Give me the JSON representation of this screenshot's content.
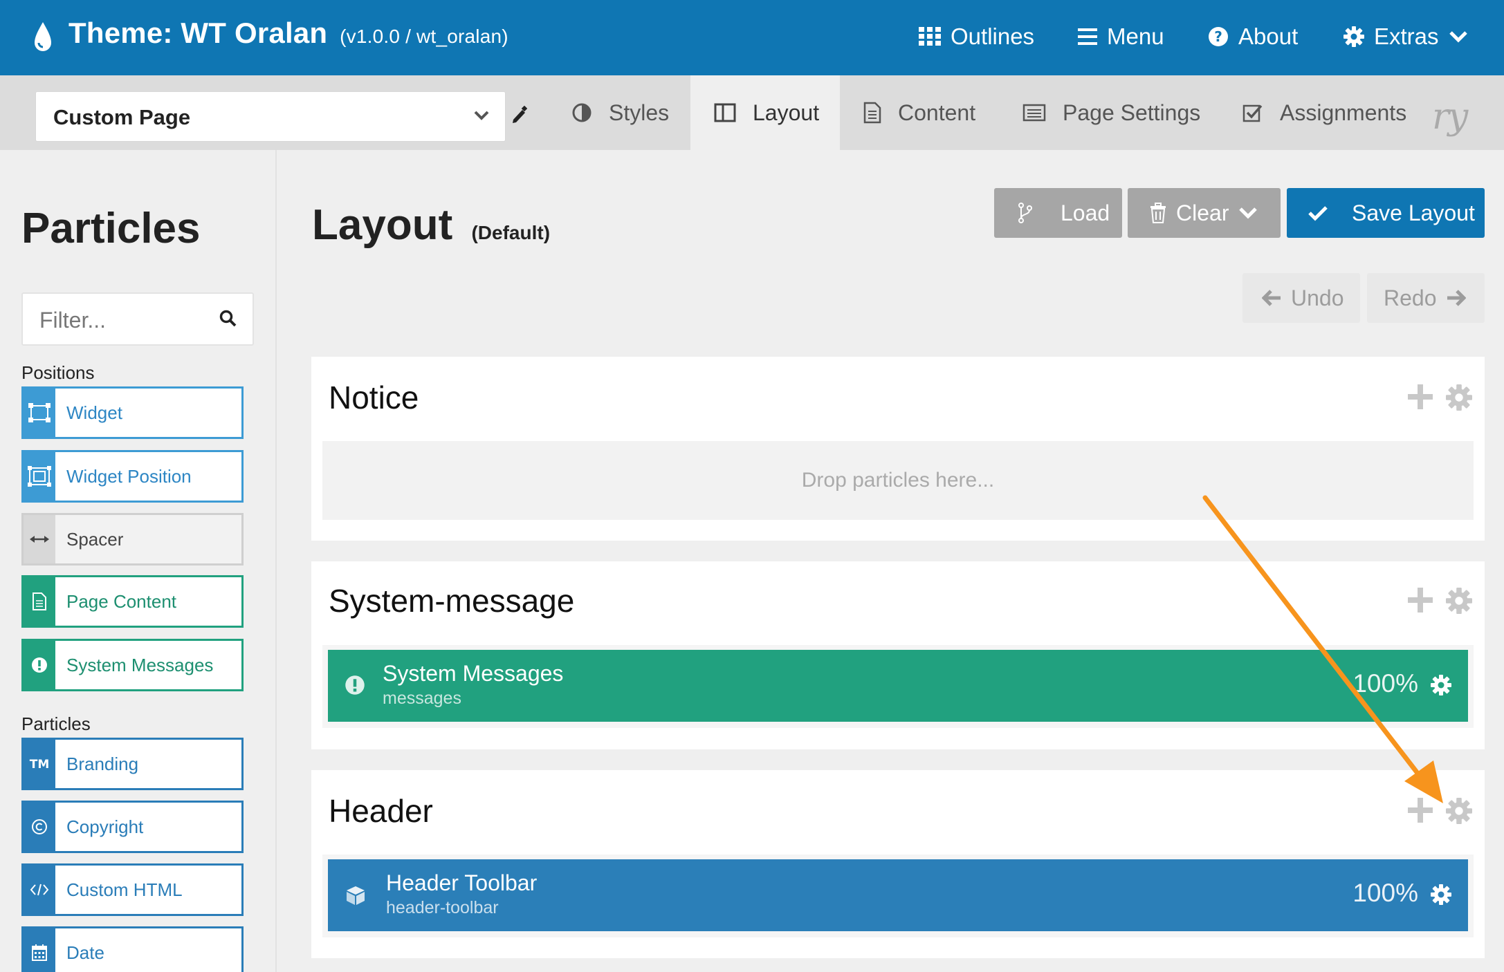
{
  "header": {
    "title": "Theme: WT Oralan",
    "version": "(v1.0.0 / wt_oralan)",
    "nav": {
      "outlines": "Outlines",
      "menu": "Menu",
      "about": "About",
      "extras": "Extras"
    }
  },
  "subbar": {
    "outline_value": "Custom Page",
    "tabs": {
      "styles": "Styles",
      "layout": "Layout",
      "content": "Content",
      "page_settings": "Page Settings",
      "assignments": "Assignments"
    },
    "brand_fragment": "ry"
  },
  "sidebar": {
    "title": "Particles",
    "filter_placeholder": "Filter...",
    "positions_label": "Positions",
    "positions": [
      "Widget",
      "Widget Position",
      "Spacer",
      "Page Content",
      "System Messages"
    ],
    "particles_label": "Particles",
    "particles": [
      "Branding",
      "Copyright",
      "Custom HTML",
      "Date"
    ]
  },
  "main": {
    "title": "Layout",
    "subtitle": "(Default)",
    "buttons": {
      "load": "Load",
      "clear": "Clear",
      "save": "Save Layout",
      "undo": "Undo",
      "redo": "Redo"
    },
    "sections": {
      "notice": {
        "name": "Notice",
        "drop_text": "Drop particles here..."
      },
      "system_message": {
        "name": "System-message",
        "particle_title": "System Messages",
        "particle_sub": "messages",
        "particle_width": "100%"
      },
      "header": {
        "name": "Header",
        "particle_title": "Header Toolbar",
        "particle_sub": "header-toolbar",
        "particle_width": "100%"
      }
    }
  },
  "colors": {
    "brand_blue": "#0f76b3",
    "system_green": "#21a17f",
    "particle_blue": "#2b7fb8",
    "annotation_orange": "#f7941d"
  }
}
